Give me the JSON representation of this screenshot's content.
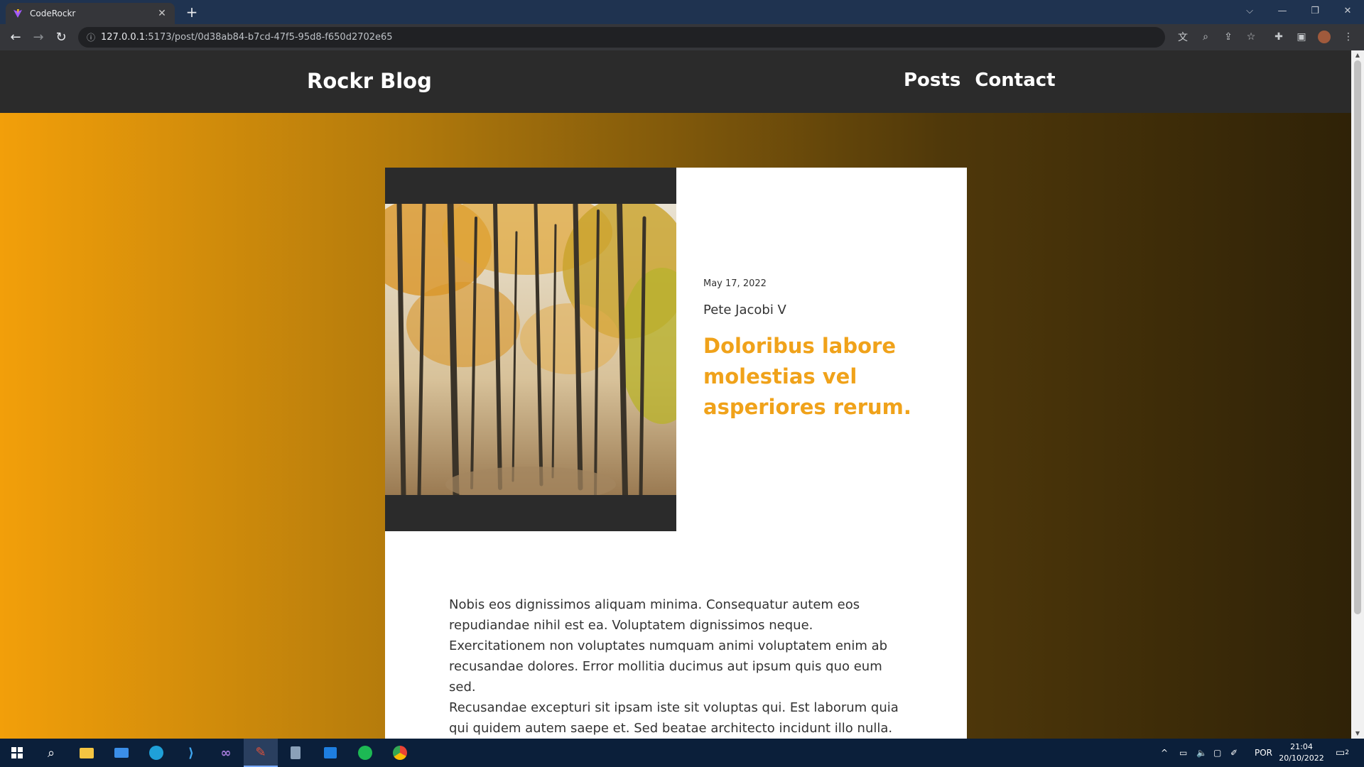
{
  "browser": {
    "tab_title": "CodeRockr",
    "new_tab_label": "+",
    "url_host": "127.0.0.1",
    "url_rest": ":5173/post/0d38ab84-b7cd-47f5-95d8-f650d2702e65"
  },
  "site": {
    "brand": "Rockr Blog",
    "nav": [
      "Posts",
      "Contact"
    ]
  },
  "post": {
    "date": "May 17, 2022",
    "author": "Pete Jacobi V",
    "title": "Doloribus labore molestias vel asperiores rerum.",
    "body": [
      "Nobis eos dignissimos aliquam minima. Consequatur autem eos repudiandae nihil est ea. Voluptatem dignissimos neque. Exercitationem non voluptates numquam animi voluptatem enim ab recusandae dolores. Error mollitia ducimus aut ipsum quis quo eum sed.",
      "Recusandae excepturi sit ipsam iste sit voluptas qui. Est laborum quia qui quidem autem saepe et. Sed beatae architecto incidunt illo nulla."
    ]
  },
  "taskbar": {
    "language": "POR",
    "time": "21:04",
    "date": "20/10/2022",
    "notifications": "2"
  },
  "colors": {
    "accent": "#f0a21a",
    "header_bg": "#2b2b2b"
  }
}
